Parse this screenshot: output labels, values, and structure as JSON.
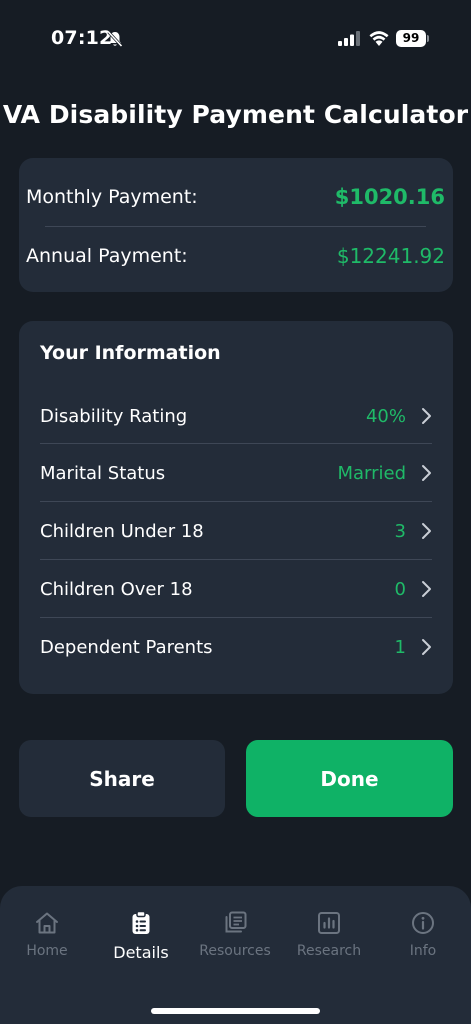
{
  "status_bar": {
    "time": "07:12",
    "battery": "99"
  },
  "page_title": "VA Disability Payment Calculator",
  "summary": {
    "monthly_label": "Monthly Payment:",
    "monthly_value": "$1020.16",
    "annual_label": "Annual Payment:",
    "annual_value": "$12241.92"
  },
  "info": {
    "title": "Your Information",
    "rows": [
      {
        "label": "Disability Rating",
        "value": "40%"
      },
      {
        "label": "Marital Status",
        "value": "Married"
      },
      {
        "label": "Children Under 18",
        "value": "3"
      },
      {
        "label": "Children Over 18",
        "value": "0"
      },
      {
        "label": "Dependent Parents",
        "value": "1"
      }
    ]
  },
  "buttons": {
    "share": "Share",
    "done": "Done"
  },
  "tabs": [
    {
      "label": "Home",
      "icon": "home-icon"
    },
    {
      "label": "Details",
      "icon": "clipboard-icon",
      "active": true
    },
    {
      "label": "Resources",
      "icon": "documents-icon"
    },
    {
      "label": "Research",
      "icon": "chart-icon"
    },
    {
      "label": "Info",
      "icon": "info-icon"
    }
  ],
  "colors": {
    "accent": "#1fba68",
    "button_green": "#0fb266",
    "background": "#161c24",
    "card": "#232c39"
  }
}
